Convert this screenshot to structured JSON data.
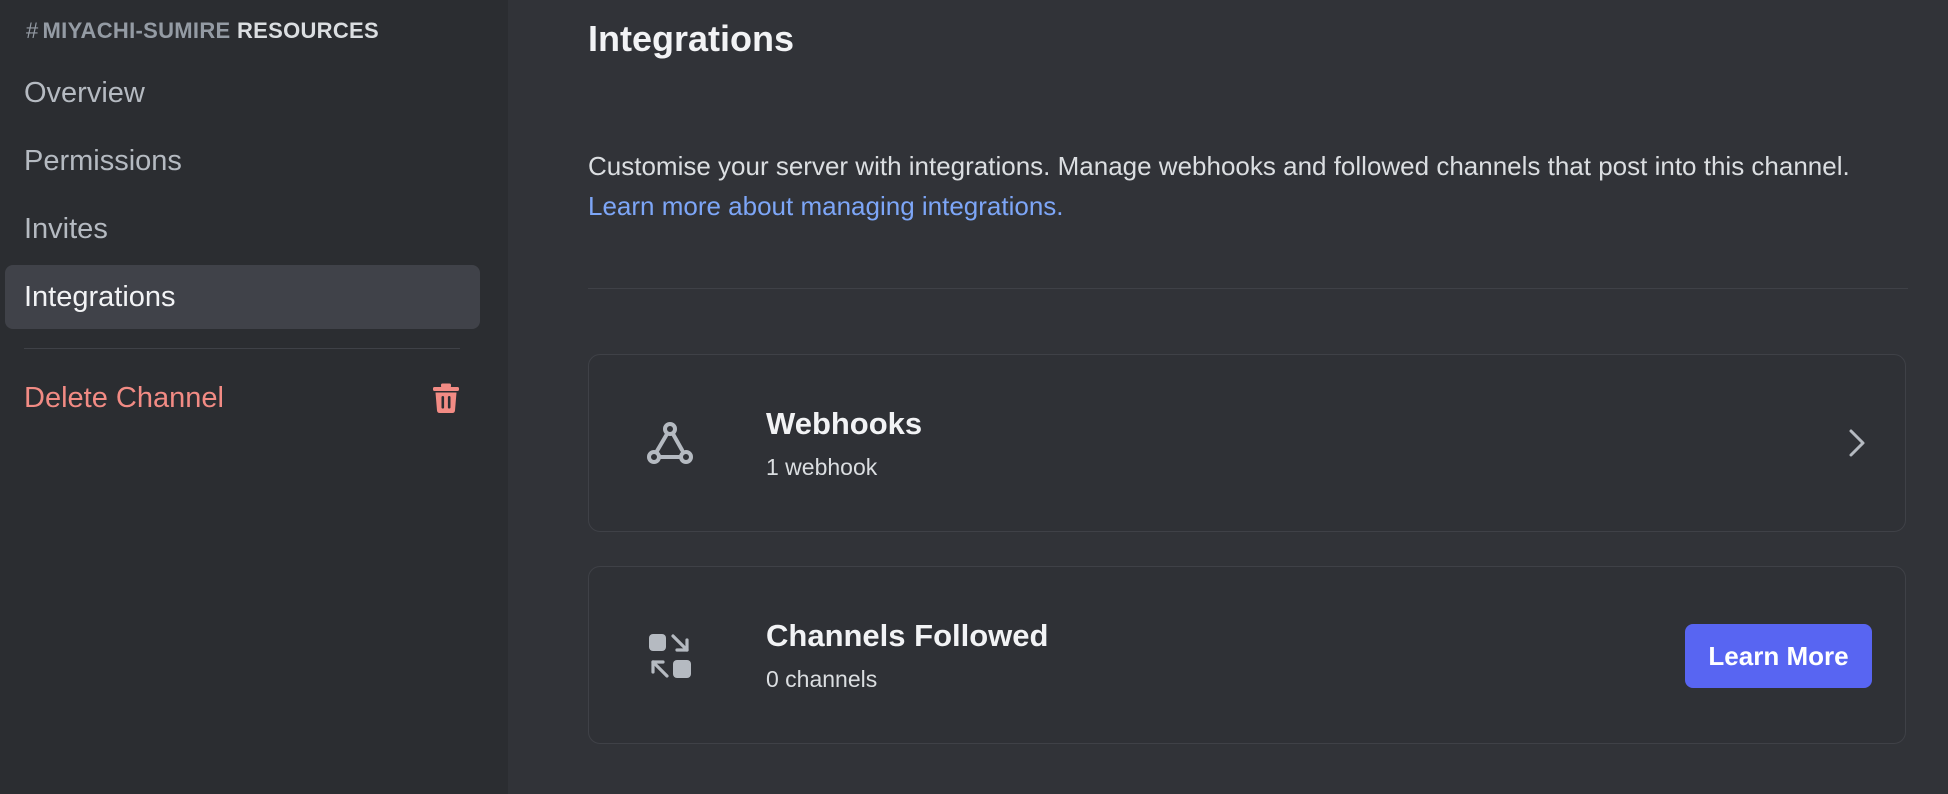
{
  "sidebar": {
    "header": {
      "hash": "#",
      "channel_name": "MIYACHI-SUMIRE",
      "section": "RESOURCES"
    },
    "items": [
      {
        "label": "Overview",
        "active": false
      },
      {
        "label": "Permissions",
        "active": false
      },
      {
        "label": "Invites",
        "active": false
      },
      {
        "label": "Integrations",
        "active": true
      }
    ],
    "delete_label": "Delete Channel",
    "delete_icon": "trash-icon",
    "delete_color": "#f28b84"
  },
  "main": {
    "title": "Integrations",
    "description": "Customise your server with integrations. Manage webhooks and followed channels that post into this channel.",
    "learn_link": "Learn more about managing integrations.",
    "cards": {
      "webhooks": {
        "title": "Webhooks",
        "subtitle": "1 webhook",
        "icon": "webhook-icon",
        "action_icon": "chevron-right-icon"
      },
      "channels_followed": {
        "title": "Channels Followed",
        "subtitle": "0 channels",
        "icon": "channel-follow-icon",
        "button_label": "Learn More"
      }
    }
  },
  "colors": {
    "background": "#313338",
    "sidebar": "#2b2d31",
    "link": "#7da6f7",
    "brand": "#5865f2"
  }
}
